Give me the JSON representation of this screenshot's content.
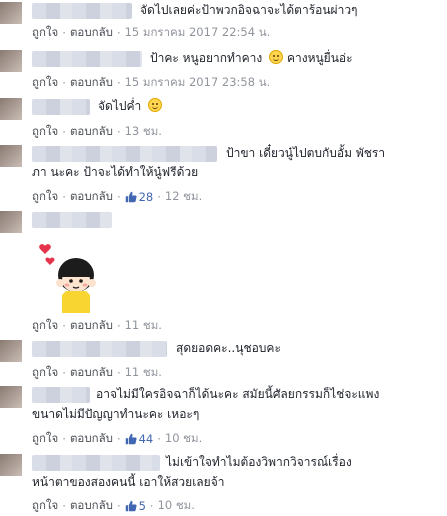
{
  "actions": {
    "like": "ถูกใจ",
    "reply": "ตอบกลับ",
    "dot": "·"
  },
  "comments": [
    {
      "text": "จัดไปเลยค่ะป้าพวกอิจฉาจะได้ตาร้อนผ่าวๆ",
      "time": "15 มกราคม 2017 22:54 น."
    },
    {
      "text": "ป้าคะ หนูอยากทำคาง",
      "text2": "คางหนูยื่นอ่ะ",
      "emoji": "relieved-face-icon",
      "time": "15 มกราคม 2017 23:58 น."
    },
    {
      "text": "จัดไปค่ำ",
      "emoji": "grinning-face-icon",
      "time": "13 ชม."
    },
    {
      "text": "ป้าขา เดี๋ยวนู๋ไปตบกับอั้ม พัชรา",
      "line2": "ภา นะคะ ป้าจะได้ทำให้นู๋ฟรีด้วย",
      "likes": "28",
      "time": "12 ชม."
    },
    {
      "sticker": "girl-heart-sticker",
      "time": "11 ชม."
    },
    {
      "text": "สุดยอดคะ..นุชอบคะ",
      "time": "11 ชม."
    },
    {
      "text": "อาจไม่มีใครอิจฉาก็ได้นะคะ สมัยนี้ศัลยกรรมก็ไช่จะแพง",
      "line2": "ขนาดไม่มีปัญญาทำนะคะ เหอะๆ",
      "likes": "44",
      "time": "10 ชม."
    },
    {
      "text": "ไม่เข้าใจทำไมต้องวิพากวิจารณ์เรื่อง",
      "line2": "หน้าตาของสองคนนี้ เอาให้สวยเลยจ้า",
      "likes": "5",
      "time": "10 ชม."
    }
  ],
  "colors": {
    "link": "#4267b2",
    "meta": "#90949c",
    "text": "#1d2129"
  }
}
